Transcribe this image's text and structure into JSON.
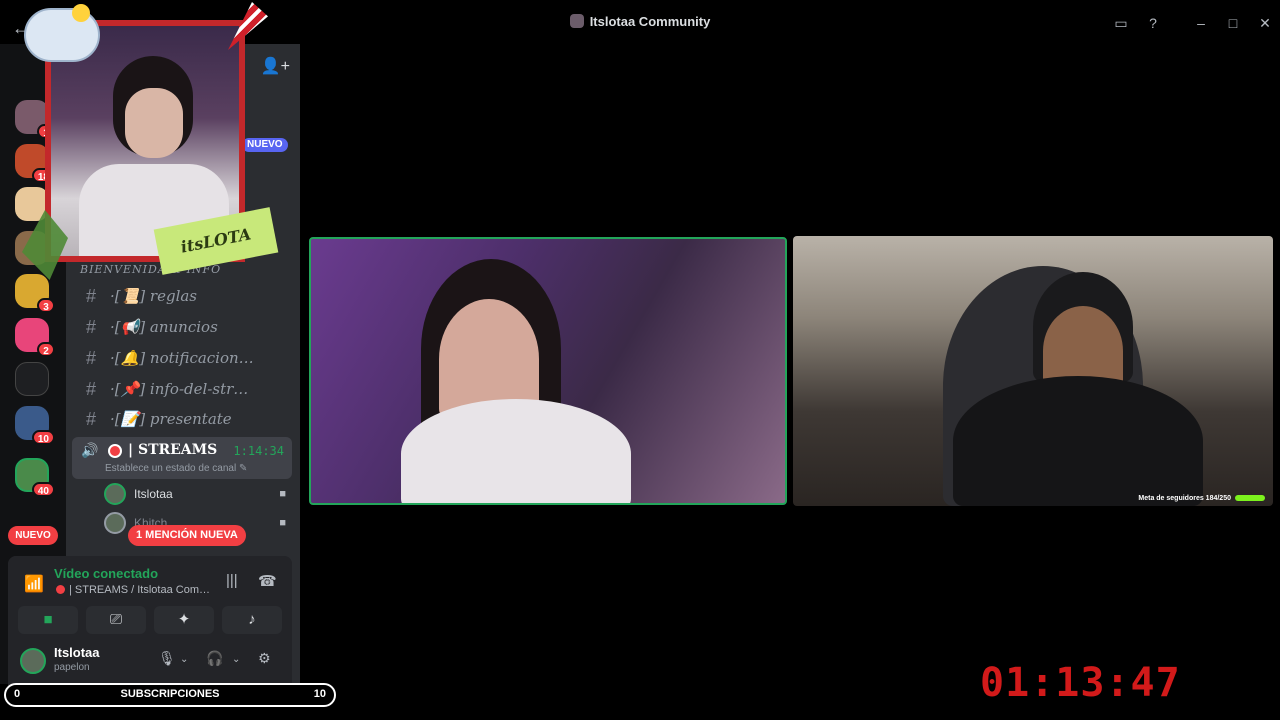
{
  "window": {
    "title": "Itslotaa Community"
  },
  "rail": {
    "servers": [
      {
        "badge": "1"
      },
      {
        "badge": "18"
      },
      {
        "badge": ""
      },
      {
        "badge": ""
      },
      {
        "badge": "3"
      },
      {
        "badge": "2"
      },
      {
        "badge": ""
      },
      {
        "badge": "10"
      },
      {
        "badge": "40"
      }
    ],
    "new_label": "NUEVO"
  },
  "sidebar": {
    "nuevo_pill": "NUEVO",
    "category": "BIENVENIDA & INFO",
    "channels": [
      {
        "name": "·[📜] reglas"
      },
      {
        "name": "·[📢] anuncios"
      },
      {
        "name": "·[🔔] notificacion…"
      },
      {
        "name": "·[📌] info-del-str…"
      },
      {
        "name": "·[📝] presentate"
      }
    ],
    "voice_channel": {
      "name": "| STREAMS",
      "time": "1:14:34",
      "status": "Establece un estado de canal"
    },
    "voice_users": [
      {
        "name": "Itslotaa"
      },
      {
        "name": "Khitch"
      }
    ],
    "mention_pill": "1 MENCIÓN NUEVA"
  },
  "voice_panel": {
    "status": "Vídeo conectado",
    "location": "| STREAMS / Itslotaa Com…"
  },
  "user_panel": {
    "username": "Itslotaa",
    "status": "papelon"
  },
  "overlay": {
    "subs_left": "0",
    "subs_label": "SUBSCRIPCIONES",
    "subs_right": "10",
    "tag": "itsLOTA",
    "timer": "01:13:47",
    "follower_goal": "Meta de seguidores 184/250"
  },
  "colors": {
    "accent_green": "#23a55a",
    "danger_red": "#f23f43",
    "blurple": "#5865f2"
  }
}
